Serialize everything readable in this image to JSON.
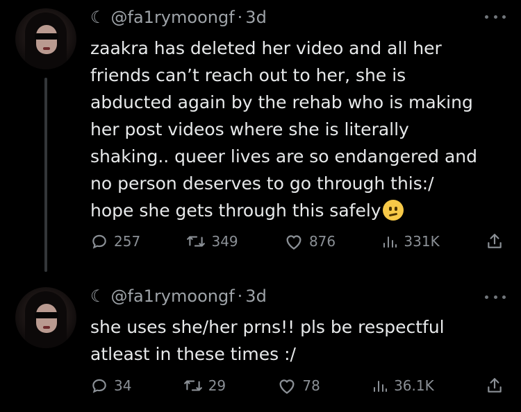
{
  "tweets": [
    {
      "moon": "☾",
      "handle": "@fa1rymoongf",
      "separator": "·",
      "time": "3d",
      "lines": [
        "zaakra has deleted her video and all her",
        "friends can’t reach out to her, she is",
        "abducted again by the rehab who is making",
        "her post videos where she is literally",
        "shaking.. queer lives are so endangered and",
        "no person deserves to go through this:/",
        "hope she gets through this safely"
      ],
      "emoji": "confused-face",
      "replies": "257",
      "retweets": "349",
      "likes": "876",
      "views": "331K"
    },
    {
      "moon": "☾",
      "handle": "@fa1rymoongf",
      "separator": "·",
      "time": "3d",
      "lines": [
        "she uses she/her prns!! pls be respectful",
        "atleast in these times :/"
      ],
      "replies": "34",
      "retweets": "29",
      "likes": "78",
      "views": "36.1K"
    }
  ],
  "colors": {
    "background": "#000000",
    "text": "#e7e9ea",
    "muted": "#71767b",
    "thread": "#333639"
  }
}
